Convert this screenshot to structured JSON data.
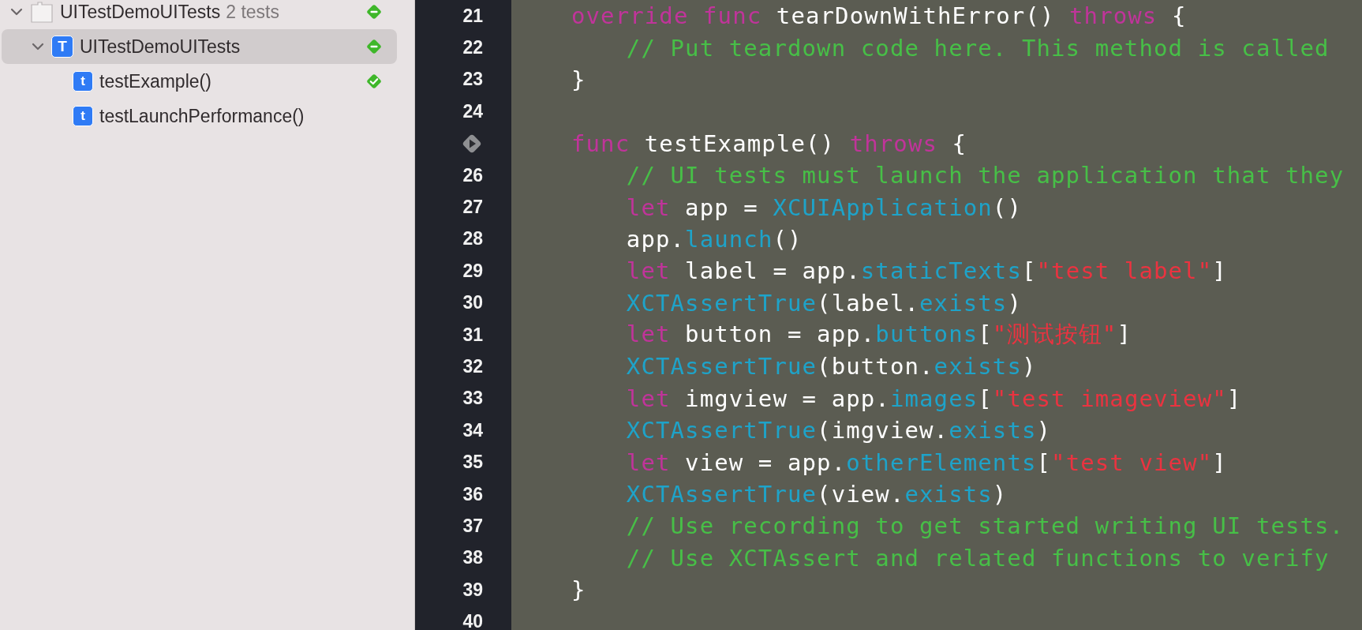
{
  "navigator": {
    "items": [
      {
        "kind": "bundle",
        "label": "UITestDemoUITests",
        "detail": "2 tests",
        "expanded": true,
        "selected": false,
        "status": {
          "kind": "minus"
        },
        "children": [
          {
            "kind": "class",
            "label": "UITestDemoUITests",
            "icon_letter": "T",
            "expanded": true,
            "selected": true,
            "status": {
              "kind": "minus"
            },
            "children": [
              {
                "kind": "method",
                "label": "testExample()",
                "icon_letter": "t",
                "selected": false,
                "status": {
                  "kind": "check"
                }
              },
              {
                "kind": "method",
                "label": "testLaunchPerformance()",
                "icon_letter": "t",
                "selected": false
              }
            ]
          }
        ]
      }
    ]
  },
  "editor": {
    "lines": [
      {
        "number": "21",
        "run_button": false,
        "tokens": [
          {
            "kind": "keyword",
            "text": "override"
          },
          {
            "kind": "keyword",
            "text": " func"
          },
          {
            "kind": "plain",
            "text": " tearDownWithError() "
          },
          {
            "kind": "keyword",
            "text": "throws"
          },
          {
            "kind": "plain",
            "text": " {"
          }
        ],
        "children": [
          {
            "number": "22",
            "run_button": false,
            "tokens": [
              {
                "kind": "comment",
                "text": "// Put teardown code here. This method is called"
              }
            ]
          }
        ]
      },
      {
        "number": "23",
        "run_button": false,
        "tokens": [
          {
            "kind": "plain",
            "text": "}"
          }
        ]
      },
      {
        "number": "24",
        "run_button": false
      },
      {
        "run_button": true,
        "tokens": [
          {
            "kind": "keyword",
            "text": "func"
          },
          {
            "kind": "plain",
            "text": " testExample() "
          },
          {
            "kind": "keyword",
            "text": "throws"
          },
          {
            "kind": "plain",
            "text": " {"
          }
        ],
        "children": [
          {
            "number": "26",
            "run_button": false,
            "tokens": [
              {
                "kind": "comment",
                "text": "// UI tests must launch the application that they"
              }
            ]
          },
          {
            "number": "27",
            "run_button": false,
            "tokens": [
              {
                "kind": "keyword",
                "text": "let"
              },
              {
                "kind": "plain",
                "text": " app = "
              },
              {
                "kind": "type",
                "text": "XCUIApplication"
              },
              {
                "kind": "plain",
                "text": "()"
              }
            ]
          },
          {
            "number": "28",
            "run_button": false,
            "tokens": [
              {
                "kind": "plain",
                "text": "app."
              },
              {
                "kind": "type",
                "text": "launch"
              },
              {
                "kind": "plain",
                "text": "()"
              }
            ]
          },
          {
            "number": "29",
            "run_button": false,
            "tokens": [
              {
                "kind": "keyword",
                "text": "let"
              },
              {
                "kind": "plain",
                "text": " label = app."
              },
              {
                "kind": "type",
                "text": "staticTexts"
              },
              {
                "kind": "plain",
                "text": "["
              },
              {
                "kind": "string",
                "text": "\"test label\""
              },
              {
                "kind": "plain",
                "text": "]"
              }
            ]
          },
          {
            "number": "30",
            "run_button": false,
            "tokens": [
              {
                "kind": "type",
                "text": "XCTAssertTrue"
              },
              {
                "kind": "plain",
                "text": "(label."
              },
              {
                "kind": "type",
                "text": "exists"
              },
              {
                "kind": "plain",
                "text": ")"
              }
            ]
          },
          {
            "number": "31",
            "run_button": false,
            "tokens": [
              {
                "kind": "keyword",
                "text": "let"
              },
              {
                "kind": "plain",
                "text": " button = app."
              },
              {
                "kind": "type",
                "text": "buttons"
              },
              {
                "kind": "plain",
                "text": "["
              },
              {
                "kind": "string",
                "text": "\"测试按钮\""
              },
              {
                "kind": "plain",
                "text": "]"
              }
            ]
          },
          {
            "number": "32",
            "run_button": false,
            "tokens": [
              {
                "kind": "type",
                "text": "XCTAssertTrue"
              },
              {
                "kind": "plain",
                "text": "(button."
              },
              {
                "kind": "type",
                "text": "exists"
              },
              {
                "kind": "plain",
                "text": ")"
              }
            ]
          },
          {
            "number": "33",
            "run_button": false,
            "tokens": [
              {
                "kind": "keyword",
                "text": "let"
              },
              {
                "kind": "plain",
                "text": " imgview = app."
              },
              {
                "kind": "type",
                "text": "images"
              },
              {
                "kind": "plain",
                "text": "["
              },
              {
                "kind": "string",
                "text": "\"test imageview\""
              },
              {
                "kind": "plain",
                "text": "]"
              }
            ]
          },
          {
            "number": "34",
            "run_button": false,
            "tokens": [
              {
                "kind": "type",
                "text": "XCTAssertTrue"
              },
              {
                "kind": "plain",
                "text": "(imgview."
              },
              {
                "kind": "type",
                "text": "exists"
              },
              {
                "kind": "plain",
                "text": ")"
              }
            ]
          },
          {
            "number": "35",
            "run_button": false,
            "tokens": [
              {
                "kind": "keyword",
                "text": "let"
              },
              {
                "kind": "plain",
                "text": " view = app."
              },
              {
                "kind": "type",
                "text": "otherElements"
              },
              {
                "kind": "plain",
                "text": "["
              },
              {
                "kind": "string",
                "text": "\"test view\""
              },
              {
                "kind": "plain",
                "text": "]"
              }
            ]
          },
          {
            "number": "36",
            "run_button": false,
            "tokens": [
              {
                "kind": "type",
                "text": "XCTAssertTrue"
              },
              {
                "kind": "plain",
                "text": "(view."
              },
              {
                "kind": "type",
                "text": "exists"
              },
              {
                "kind": "plain",
                "text": ")"
              }
            ]
          },
          {
            "number": "37",
            "run_button": false,
            "tokens": [
              {
                "kind": "comment",
                "text": "// Use recording to get started writing UI tests."
              }
            ]
          },
          {
            "number": "38",
            "run_button": false,
            "tokens": [
              {
                "kind": "comment",
                "text": "// Use XCTAssert and related functions to verify"
              }
            ]
          }
        ]
      },
      {
        "number": "39",
        "run_button": false,
        "tokens": [
          {
            "kind": "plain",
            "text": "}"
          }
        ]
      },
      {
        "number": "40",
        "run_button": false
      }
    ]
  }
}
